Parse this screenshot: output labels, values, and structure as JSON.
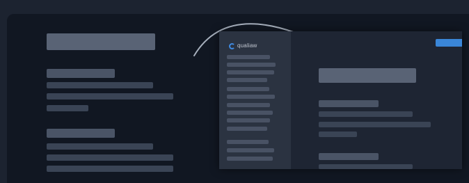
{
  "app": {
    "brand_name": "qualiaw"
  },
  "colors": {
    "background": "#1c2330",
    "panel": "#111722",
    "sidebar": "#2b3341",
    "placeholder": "#3a4455",
    "accent": "#3a86d8"
  },
  "icons": {
    "transition_arrow": "curved-arrow-right-icon",
    "brand_logo": "spinner-logo-icon"
  }
}
